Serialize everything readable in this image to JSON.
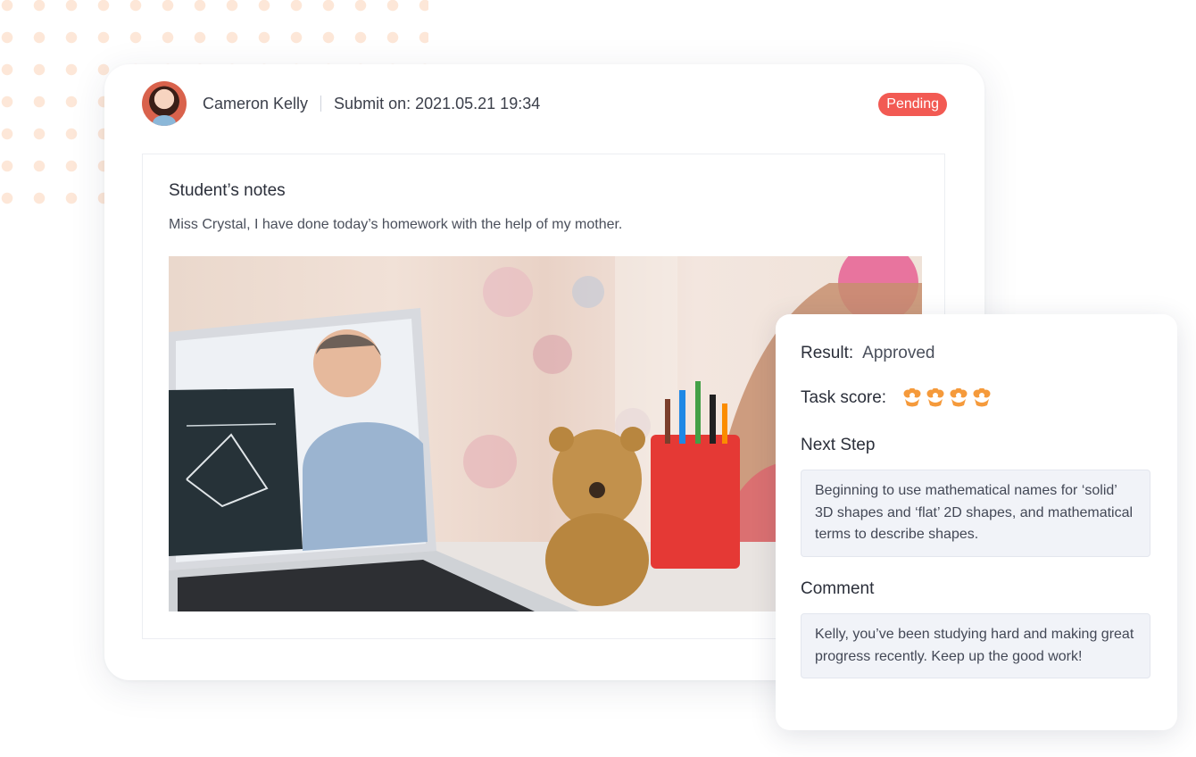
{
  "submission": {
    "student_name": "Cameron Kelly",
    "submitted_at": "Submit on: 2021.05.21  19:34",
    "status": "Pending",
    "status_color": "#f25a53",
    "notes_title": "Student’s notes",
    "notes_text": "Miss Crystal, I have done today’s homework with the help of my mother."
  },
  "review": {
    "result_label": "Result:",
    "result_value": "Approved",
    "score_label": "Task score:",
    "score_stars": 4,
    "score_icon": "flower-icon",
    "score_color": "#f59a3b",
    "next_step_title": "Next Step",
    "next_step_text": "Beginning to use mathematical names for ‘solid’ 3D shapes and ‘flat’ 2D shapes, and mathematical terms to describe shapes.",
    "comment_title": "Comment",
    "comment_text": "Kelly, you’ve been studying hard and making great progress recently. Keep up the good work!"
  }
}
